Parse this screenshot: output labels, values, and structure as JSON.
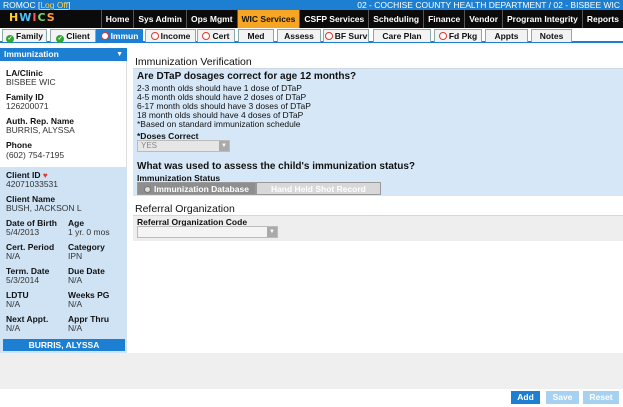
{
  "titlebar": {
    "app": "ROMOC [",
    "logoff": "Log Off",
    "close": "]",
    "location": "02 - COCHISE COUNTY HEALTH DEPARTMENT / 02 - BISBEE WIC"
  },
  "logo": {
    "letters": [
      "H",
      "W",
      "I",
      "C",
      "S"
    ],
    "tagline": ""
  },
  "nav": {
    "items": [
      "Home",
      "Sys Admin",
      "Ops Mgmt",
      "WIC Services",
      "CSFP Services",
      "Scheduling",
      "Finance",
      "Vendor",
      "Program Integrity",
      "Reports"
    ],
    "active": "WIC Services"
  },
  "tabs": [
    {
      "label": "Family",
      "status": "ok"
    },
    {
      "label": "Client",
      "status": "ok"
    },
    {
      "label": "Immun",
      "status": "req",
      "active": true
    },
    {
      "label": "Income",
      "status": "req"
    },
    {
      "label": "Cert",
      "status": "req"
    },
    {
      "label": "Med",
      "status": "none"
    },
    {
      "label": "Assess",
      "status": "none"
    },
    {
      "label": "BF Surv",
      "status": "req"
    },
    {
      "label": "Care Plan",
      "status": "none"
    },
    {
      "label": "Fd Pkg",
      "status": "req"
    },
    {
      "label": "Appts",
      "status": "none"
    },
    {
      "label": "Notes",
      "status": "none"
    }
  ],
  "sidebar": {
    "header": "Immunization",
    "la_clinic_label": "LA/Clinic",
    "la_clinic_value": "BISBEE WIC",
    "family_id_label": "Family ID",
    "family_id_value": "126200071",
    "auth_rep_label": "Auth. Rep. Name",
    "auth_rep_value": "BURRIS, ALYSSA",
    "phone_label": "Phone",
    "phone_value": "(602) 754-7195",
    "client_id_label": "Client ID",
    "client_id_value": "42071033531",
    "client_name_label": "Client Name",
    "client_name_value": "BUSH, JACKSON L",
    "dob_label": "Date of Birth",
    "dob_value": "5/4/2013",
    "age_label": "Age",
    "age_value": "1 yr. 0 mos",
    "cert_period_label": "Cert. Period",
    "cert_period_value": "N/A",
    "category_label": "Category",
    "category_value": "IPN",
    "term_date_label": "Term. Date",
    "term_date_value": "5/3/2014",
    "due_date_label": "Due Date",
    "due_date_value": "N/A",
    "ldtu_label": "LDTU",
    "ldtu_value": "N/A",
    "weeks_pg_label": "Weeks PG",
    "weeks_pg_value": "N/A",
    "next_appt_label": "Next Appt.",
    "next_appt_value": "N/A",
    "appr_thru_label": "Appr Thru",
    "appr_thru_value": "N/A",
    "footer": "BURRIS, ALYSSA"
  },
  "main": {
    "immun_title": "Immunization Verification",
    "q1": "Are DTaP dosages correct for age 12 months?",
    "lines": [
      "2-3 month olds should have 1 dose of DTaP",
      "4-5 month olds should have 2 doses of DTaP",
      "6-17 month olds should have 3 doses of DTaP",
      "18 month olds should have 4 doses of DTaP",
      "*Based on standard immunization schedule"
    ],
    "doses_label": "*Doses Correct",
    "doses_value": "YES",
    "q2": "What was used to assess the child's immunization status?",
    "status_label": "Immunization Status",
    "opt1": "Immunization Database",
    "opt2": "Hand Held Shot Record",
    "referral_title": "Referral Organization",
    "referral_code_label": "Referral Organization Code",
    "referral_code_value": ""
  },
  "buttons": {
    "add": "Add",
    "save": "Save",
    "reset": "Reset"
  }
}
